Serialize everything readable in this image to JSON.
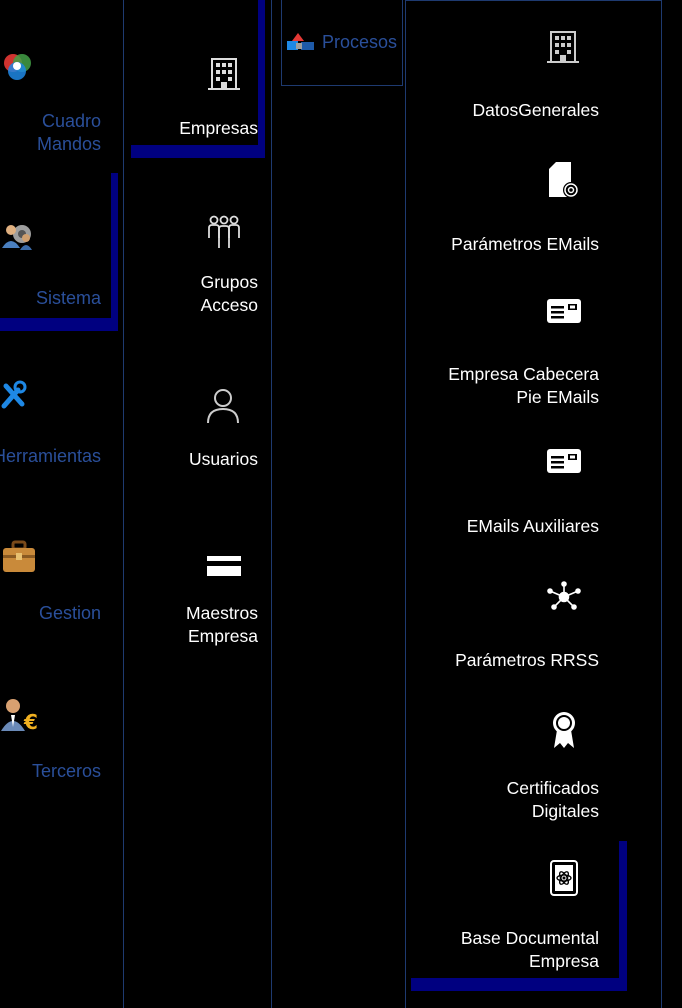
{
  "nav": {
    "items": [
      {
        "label_line1": "Cuadro",
        "label_line2": "Mandos",
        "icon": "color-wheel-icon"
      },
      {
        "label": "Sistema",
        "icon": "users-gear-icon",
        "selected": true
      },
      {
        "label": "Herramientas",
        "icon": "tools-icon"
      },
      {
        "label": "Gestion",
        "icon": "briefcase-icon"
      },
      {
        "label": "Terceros",
        "icon": "person-euro-icon"
      }
    ]
  },
  "sub": {
    "items": [
      {
        "label": "Empresas",
        "icon": "building-icon",
        "selected": true
      },
      {
        "label_line1": "Grupos",
        "label_line2": "Acceso",
        "icon": "group-icon"
      },
      {
        "label": "Usuarios",
        "icon": "user-icon"
      },
      {
        "label_line1": "Maestros",
        "label_line2": "Empresa",
        "icon": "bars-icon"
      }
    ]
  },
  "process": {
    "label": "Procesos",
    "icon": "shapes-icon"
  },
  "options": {
    "items": [
      {
        "label": "DatosGenerales",
        "icon": "building-icon"
      },
      {
        "label": "Parámetros EMails",
        "icon": "file-at-icon"
      },
      {
        "label_line1": "Empresa Cabecera",
        "label_line2": "Pie EMails",
        "icon": "card-icon"
      },
      {
        "label": "EMails Auxiliares",
        "icon": "card-icon"
      },
      {
        "label": "Parámetros RRSS",
        "icon": "network-icon"
      },
      {
        "label_line1": "Certificados",
        "label_line2": "Digitales",
        "icon": "award-icon"
      },
      {
        "label_line1": "Base Documental",
        "label_line2": "Empresa",
        "icon": "atom-book-icon",
        "selected": true
      }
    ]
  },
  "colors": {
    "background": "#000000",
    "nav_text": "#2a4f9a",
    "selection_bar": "#000080",
    "divider": "#1e3a70"
  }
}
